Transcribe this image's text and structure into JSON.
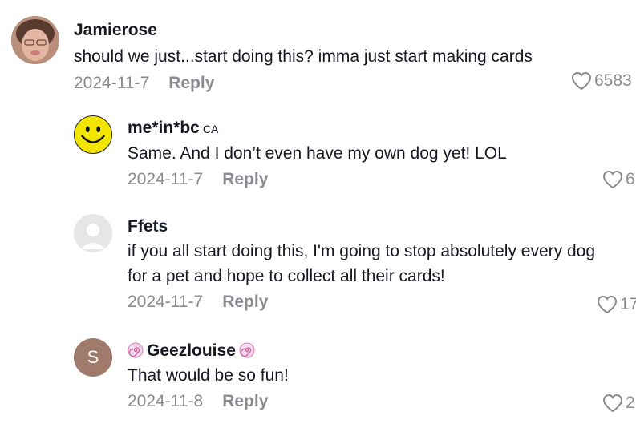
{
  "comments": [
    {
      "username": "Jamierose",
      "text": "should we just...start doing this? imma just start making cards",
      "date": "2024-11-7",
      "reply_label": "Reply",
      "likes": "6583",
      "avatar": "photo-avatar"
    },
    {
      "username": "me*in*bc",
      "tag": "CA",
      "text": "Same. And I don’t even have my own dog yet! LOL",
      "date": "2024-11-7",
      "reply_label": "Reply",
      "likes": "6",
      "avatar": "smiley-face-avatar"
    },
    {
      "username": "Ffets",
      "text_line1": "if you all start doing this, I'm going to stop absolutely every dog",
      "text_line2": "for a pet and hope to collect all their cards!",
      "date": "2024-11-7",
      "reply_label": "Reply",
      "likes": "17",
      "avatar": "default-avatar"
    },
    {
      "username": "Geezlouise",
      "avatar_letter": "S",
      "text": "That would be so fun!",
      "date": "2024-11-8",
      "reply_label": "Reply",
      "likes": "2",
      "avatar": "letter-avatar"
    }
  ],
  "colors": {
    "text": "#161823",
    "muted": "#8a8b91",
    "smiley_yellow": "#f2e600",
    "letter_avatar": "#a07a6a",
    "default_avatar": "#e6e6e9"
  }
}
